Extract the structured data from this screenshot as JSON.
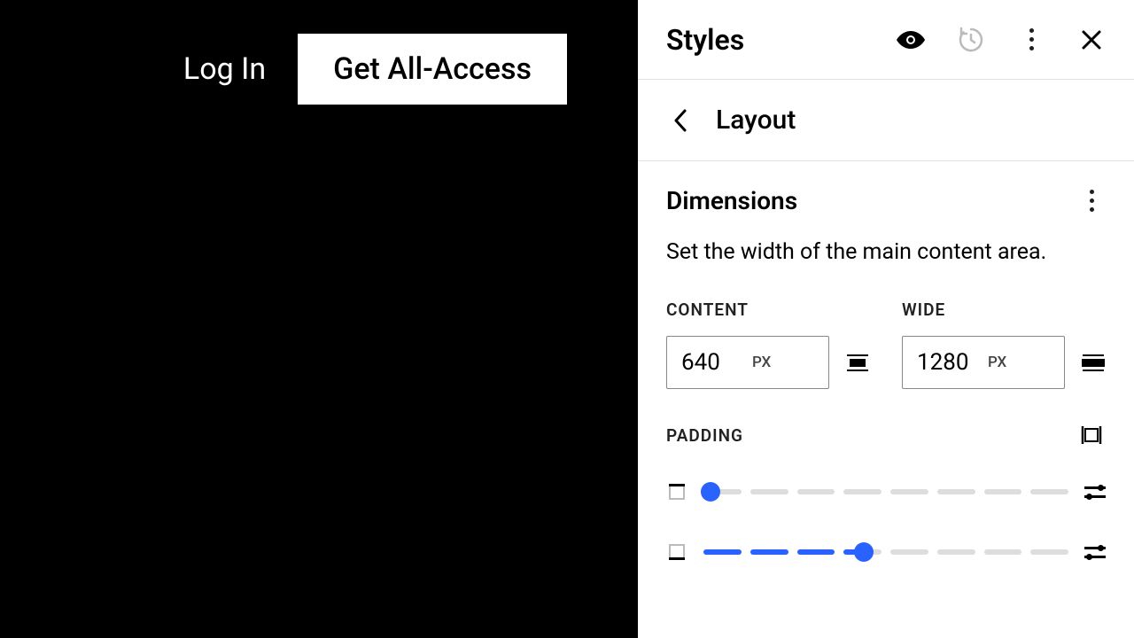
{
  "left": {
    "login": "Log In",
    "get_access": "Get All-Access"
  },
  "panel": {
    "title": "Styles",
    "breadcrumb": "Layout",
    "dimensions": {
      "title": "Dimensions",
      "desc": "Set the width of the main content area.",
      "content_label": "CONTENT",
      "content_value": "640",
      "content_unit": "PX",
      "wide_label": "WIDE",
      "wide_value": "1280",
      "wide_unit": "PX"
    },
    "padding": {
      "label": "PADDING"
    }
  }
}
